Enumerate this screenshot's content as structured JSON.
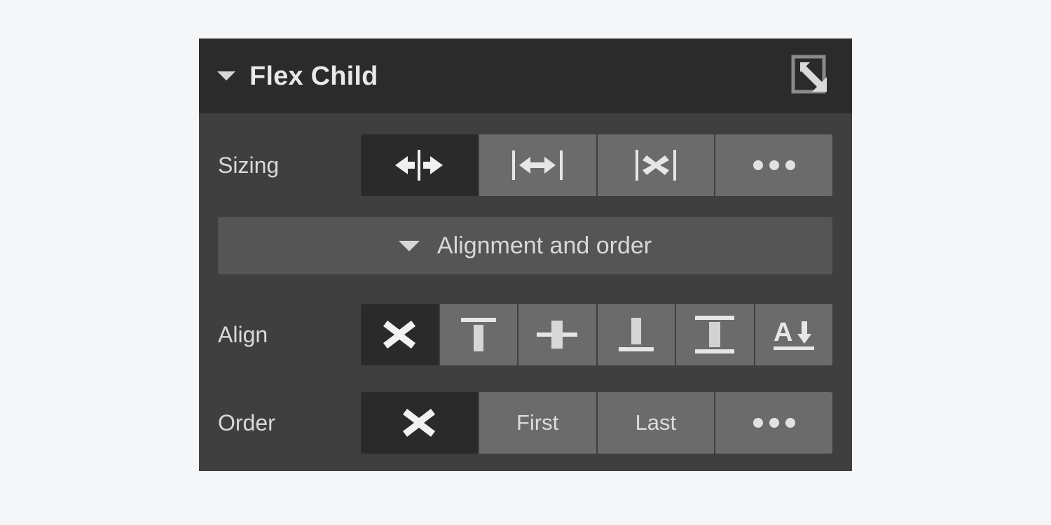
{
  "theme": {
    "page_background": "#f5f6f8",
    "panel_background": "#3f3f3f",
    "header_background": "#2b2b2b",
    "button_background": "#6b6b6b",
    "button_active_background": "#2a2a2a",
    "subsection_background": "#555555",
    "text_color": "#d9d9d9",
    "icon_color": "#e6e6e6"
  },
  "panel": {
    "title": "Flex Child",
    "collapse_caret_icon": "caret-down-icon",
    "open_icon": "open-in-new-icon"
  },
  "rows": {
    "sizing": {
      "label": "Sizing",
      "options": [
        {
          "id": "shrink-if-needed",
          "icon": "shrink-horizontal-icon",
          "label": "",
          "active": true
        },
        {
          "id": "grow-if-possible",
          "icon": "grow-horizontal-icon",
          "label": "",
          "active": false
        },
        {
          "id": "dont-shrink-or-grow",
          "icon": "no-shrink-grow-icon",
          "label": "",
          "active": false
        },
        {
          "id": "more-sizing-options",
          "icon": "ellipsis-icon",
          "label": "",
          "active": false
        }
      ]
    },
    "subsection": {
      "label": "Alignment and order",
      "caret_icon": "caret-down-icon",
      "expanded": true
    },
    "align": {
      "label": "Align",
      "options": [
        {
          "id": "align-auto",
          "icon": "cross-icon",
          "label": "",
          "active": true
        },
        {
          "id": "align-start",
          "icon": "align-start-icon",
          "label": "",
          "active": false
        },
        {
          "id": "align-center",
          "icon": "align-center-icon",
          "label": "",
          "active": false
        },
        {
          "id": "align-end",
          "icon": "align-end-icon",
          "label": "",
          "active": false
        },
        {
          "id": "align-stretch",
          "icon": "align-stretch-icon",
          "label": "",
          "active": false
        },
        {
          "id": "align-baseline",
          "icon": "align-baseline-icon",
          "label": "",
          "active": false
        }
      ]
    },
    "order": {
      "label": "Order",
      "options": [
        {
          "id": "order-auto",
          "icon": "cross-icon",
          "label": "",
          "active": true
        },
        {
          "id": "order-first",
          "icon": "",
          "label": "First",
          "active": false
        },
        {
          "id": "order-last",
          "icon": "",
          "label": "Last",
          "active": false
        },
        {
          "id": "more-order-options",
          "icon": "ellipsis-icon",
          "label": "",
          "active": false
        }
      ]
    }
  }
}
